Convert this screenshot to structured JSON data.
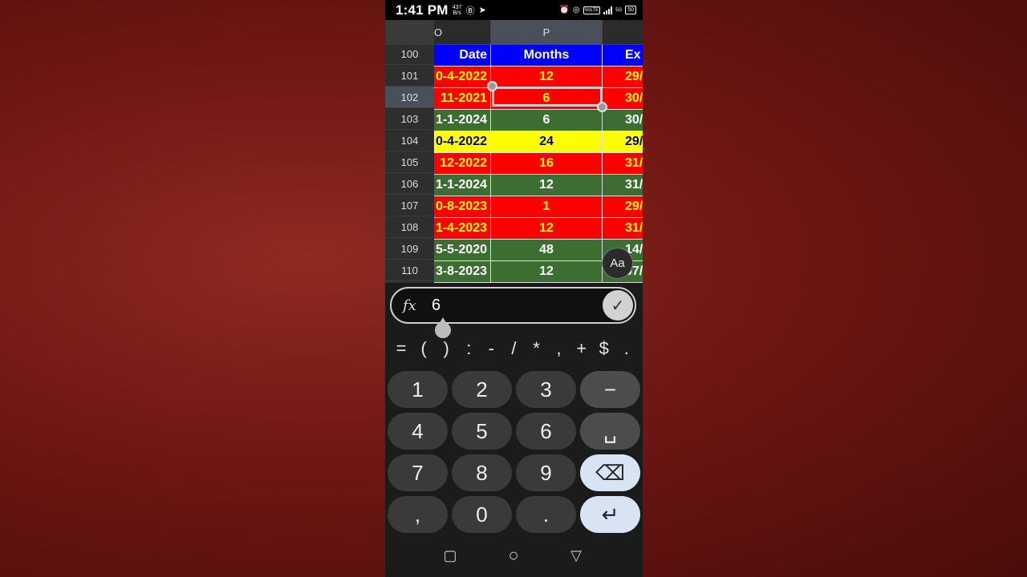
{
  "status_bar": {
    "time": "1:41 PM",
    "net_speed_top": "437",
    "net_speed_bottom": "B/s",
    "battery": "50",
    "volte": "VoLTE",
    "network": "5G"
  },
  "sheet": {
    "columns": [
      {
        "label": "O"
      },
      {
        "label": "P"
      }
    ],
    "rows": [
      {
        "num": "100",
        "date": "Date",
        "months": "Months",
        "exp": "Ex",
        "style": "hdr"
      },
      {
        "num": "101",
        "date": "0-4-2022",
        "months": "12",
        "exp": "29/",
        "style": "red"
      },
      {
        "num": "102",
        "date": "11-2021",
        "months": "6",
        "exp": "30/",
        "style": "red"
      },
      {
        "num": "103",
        "date": "1-1-2024",
        "months": "6",
        "exp": "30/",
        "style": "green"
      },
      {
        "num": "104",
        "date": "0-4-2022",
        "months": "24",
        "exp": "29/",
        "style": "yellow"
      },
      {
        "num": "105",
        "date": "12-2022",
        "months": "16",
        "exp": "31/",
        "style": "red"
      },
      {
        "num": "106",
        "date": "1-1-2024",
        "months": "12",
        "exp": "31/",
        "style": "green"
      },
      {
        "num": "107",
        "date": "0-8-2023",
        "months": "1",
        "exp": "29/",
        "style": "red"
      },
      {
        "num": "108",
        "date": "1-4-2023",
        "months": "12",
        "exp": "31/",
        "style": "red"
      },
      {
        "num": "109",
        "date": "5-5-2020",
        "months": "48",
        "exp": "14/",
        "style": "green"
      },
      {
        "num": "110",
        "date": "3-8-2023",
        "months": "12",
        "exp": "07/",
        "style": "green"
      }
    ],
    "selected_row": "102",
    "text_format_button": "Aa"
  },
  "formula_bar": {
    "fx_label": "fx",
    "value": "6",
    "confirm_icon": "check-icon"
  },
  "symbols": [
    "=",
    "(",
    ")",
    ":",
    "-",
    "/",
    "*",
    ",",
    "+",
    "$",
    "."
  ],
  "keypad": {
    "row1": [
      "1",
      "2",
      "3",
      "−"
    ],
    "row2": [
      "4",
      "5",
      "6",
      "␣"
    ],
    "row3": [
      "7",
      "8",
      "9",
      "⌫"
    ],
    "row4": [
      ",",
      "0",
      ".",
      "↵"
    ]
  },
  "nav": {
    "recents": "▢",
    "home": "○",
    "back": "▽"
  },
  "colors": {
    "header_blue": "#0000ff",
    "row_red": "#ff0000",
    "row_green": "#3c6e32",
    "row_yellow": "#ffff00",
    "key_light": "#d8e3f4"
  }
}
